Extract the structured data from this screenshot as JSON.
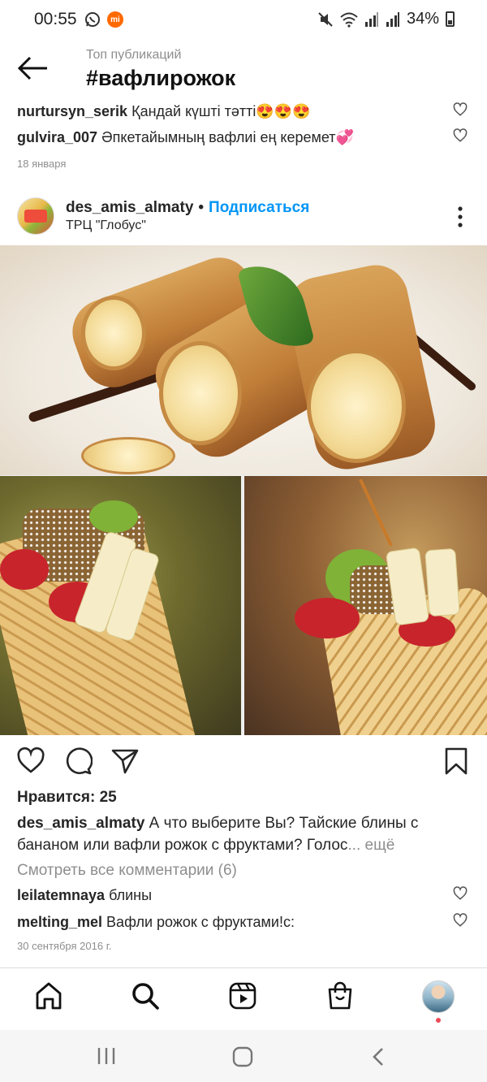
{
  "status_bar": {
    "time": "00:55",
    "battery": "34%",
    "icons": [
      "whatsapp-icon",
      "mi-icon",
      "mute-icon",
      "wifi-icon",
      "signal-icon",
      "signal-icon",
      "battery-icon"
    ]
  },
  "header": {
    "subtitle": "Топ публикаций",
    "title": "#вафлирожок"
  },
  "prev_comments": [
    {
      "user": "nurtursyn_serik",
      "text": "Қандай күшті тәтті😍😍😍"
    },
    {
      "user": "gulvira_007",
      "text": "Әпкетайымның вафлиі ең керемет💞"
    }
  ],
  "prev_date": "18 января",
  "post": {
    "username": "des_amis_almaty",
    "separator": "•",
    "subscribe_label": "Подписаться",
    "location": "ТРЦ \"Глобус\"",
    "likes": "Нравится: 25",
    "caption_user": "des_amis_almaty",
    "caption_text": "А что выберите Вы? Тайские блины с бананом или вафли рожок с фруктами? Голос",
    "caption_more": "... ещё",
    "view_all": "Смотреть все комментарии (6)",
    "comments": [
      {
        "user": "leilatemnaya",
        "text": "блины"
      },
      {
        "user": "melting_mel",
        "text": "Вафли рожок с фруктами!c:"
      }
    ],
    "date": "30 сентября 2016 г."
  },
  "colors": {
    "link": "#0095f6",
    "secondary_text": "#8e8e8e",
    "notification": "#ed4956"
  }
}
